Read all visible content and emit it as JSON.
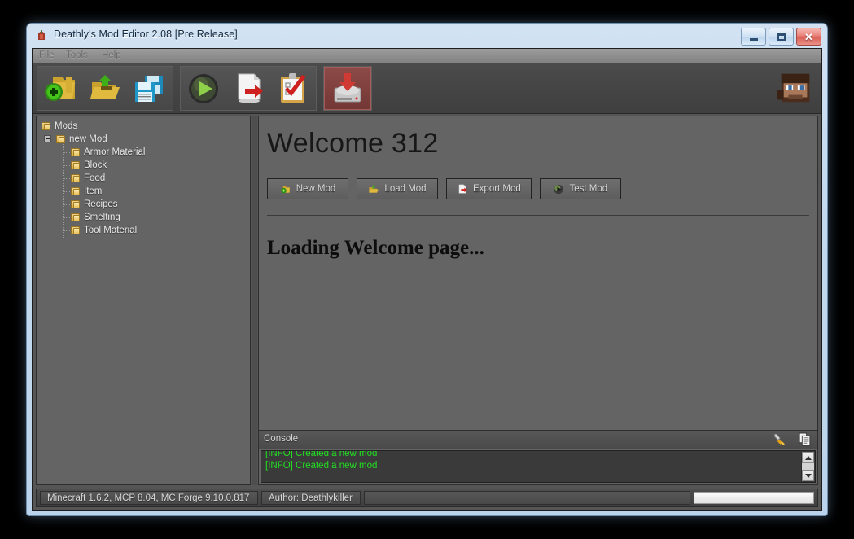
{
  "window": {
    "title": "Deathly's Mod Editor 2.08 [Pre Release]",
    "icon": "app-icon",
    "controls": {
      "minimize": "minimize-icon",
      "maximize": "maximize-icon",
      "close": "✕"
    }
  },
  "menubar": {
    "items": [
      {
        "label": "File"
      },
      {
        "label": "Tools"
      },
      {
        "label": "Help"
      }
    ]
  },
  "toolbar": {
    "buttons": [
      {
        "name": "new-mod-toolbar-button",
        "icon": "folder-add-icon",
        "group": 1
      },
      {
        "name": "load-mod-toolbar-button",
        "icon": "folder-open-icon",
        "group": 1
      },
      {
        "name": "save-mod-toolbar-button",
        "icon": "floppy-save-icon",
        "group": 1
      },
      {
        "name": "run-toolbar-button",
        "icon": "play-icon",
        "group": 2
      },
      {
        "name": "export-toolbar-button",
        "icon": "document-export-icon",
        "group": 2
      },
      {
        "name": "checklist-toolbar-button",
        "icon": "clipboard-check-icon",
        "group": 2
      },
      {
        "name": "install-toolbar-button",
        "icon": "hard-drive-download-icon",
        "group": 3,
        "highlighted": true
      }
    ],
    "avatar": "minecraft-head-icon"
  },
  "sidebar": {
    "tree": [
      {
        "label": "Mods",
        "depth": 0,
        "expander": "none"
      },
      {
        "label": "new Mod",
        "depth": 1,
        "expander": "minus"
      },
      {
        "label": "Armor Material",
        "depth": 2,
        "expander": "none"
      },
      {
        "label": "Block",
        "depth": 2,
        "expander": "none"
      },
      {
        "label": "Food",
        "depth": 2,
        "expander": "none"
      },
      {
        "label": "Item",
        "depth": 2,
        "expander": "none"
      },
      {
        "label": "Recipes",
        "depth": 2,
        "expander": "none"
      },
      {
        "label": "Smelting",
        "depth": 2,
        "expander": "none"
      },
      {
        "label": "Tool Material",
        "depth": 2,
        "expander": "none"
      }
    ]
  },
  "main": {
    "heading": "Welcome 312",
    "buttons": [
      {
        "label": "New Mod",
        "icon": "folder-add-icon"
      },
      {
        "label": "Load Mod",
        "icon": "folder-open-icon"
      },
      {
        "label": "Export Mod",
        "icon": "document-export-icon"
      },
      {
        "label": "Test Mod",
        "icon": "play-icon"
      }
    ],
    "loading_text": "Loading Welcome page..."
  },
  "console": {
    "title": "Console",
    "icons": [
      {
        "name": "clear-console-icon"
      },
      {
        "name": "copy-console-icon"
      }
    ],
    "lines": [
      {
        "text": "[INFO] Created a new mod"
      },
      {
        "text": "[INFO] Created a new mod"
      }
    ]
  },
  "statusbar": {
    "version_info": "Minecraft 1.6.2, MCP 8.04, MC Forge 9.10.0.817",
    "author": "Author: Deathlykiller",
    "progress_value": 0
  },
  "colors": {
    "panel_bg": "#646464",
    "toolbar_bg": "#464646",
    "console_text": "#22e022",
    "highlight_red": "#8c4a48",
    "folder_yellow": "#d8ab3d"
  }
}
